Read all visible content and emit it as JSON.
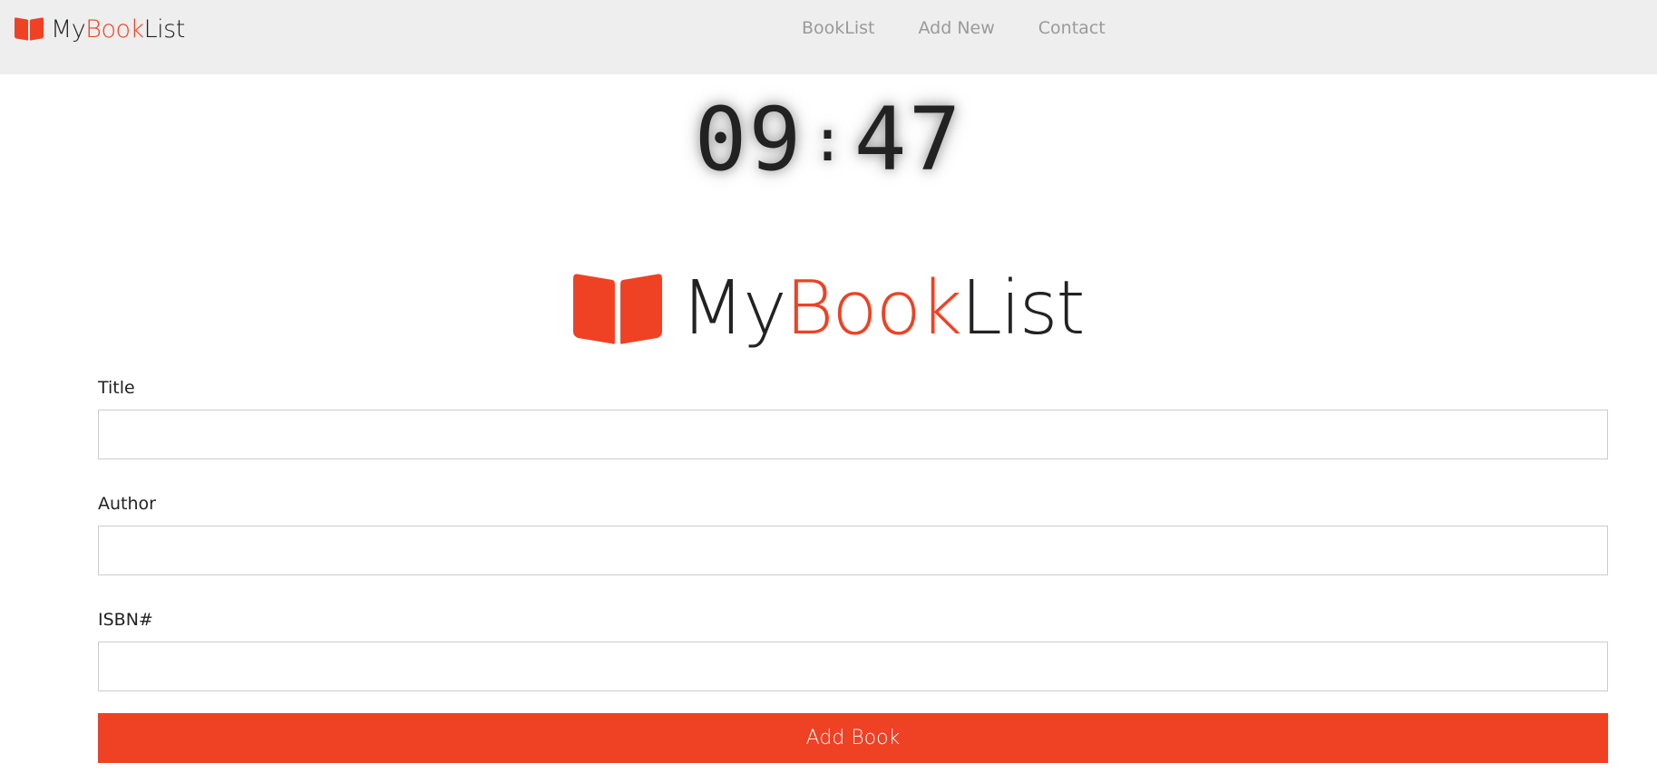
{
  "navbar": {
    "brand": {
      "icon": "open-book-icon",
      "part1": "My",
      "part2": "Book",
      "part3": "List"
    },
    "links": [
      {
        "label": "BookList"
      },
      {
        "label": "Add New"
      },
      {
        "label": "Contact"
      }
    ]
  },
  "clock": {
    "hours": "09",
    "separator": ":",
    "minutes": "47"
  },
  "hero": {
    "icon": "open-book-icon",
    "part1": "My",
    "part2": "Book",
    "part3": "List"
  },
  "form": {
    "title_label": "Title",
    "title_value": "",
    "author_label": "Author",
    "author_value": "",
    "isbn_label": "ISBN#",
    "isbn_value": "",
    "submit_label": "Add Book"
  },
  "colors": {
    "accent": "#ef4124",
    "navbar_bg": "#eeeeee",
    "text_dark": "#222222",
    "nav_link": "#9a9a9a"
  }
}
